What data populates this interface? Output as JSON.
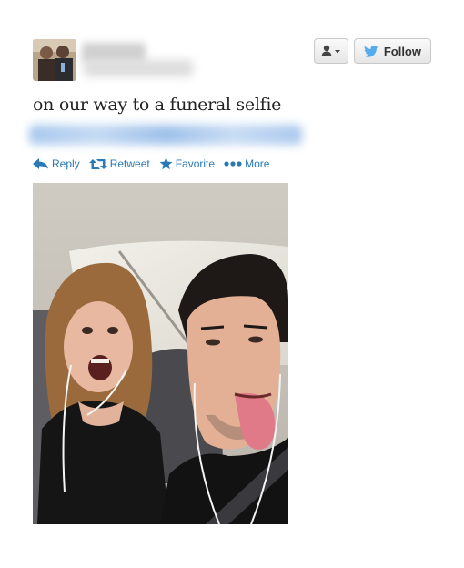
{
  "tweet": {
    "text": "on our way to a funeral selfie"
  },
  "header": {
    "follow_label": "Follow"
  },
  "actions": [
    {
      "label": "Reply",
      "icon": "reply-icon"
    },
    {
      "label": "Retweet",
      "icon": "retweet-icon"
    },
    {
      "label": "Favorite",
      "icon": "star-icon"
    },
    {
      "label": "More",
      "icon": "more-dots-icon"
    }
  ],
  "colors": {
    "link": "#2a7ab8",
    "twitter_blue": "#55acee"
  }
}
